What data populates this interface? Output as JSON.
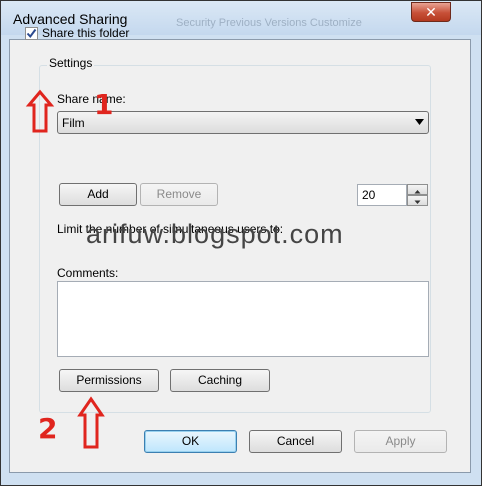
{
  "window": {
    "title": "Advanced Sharing",
    "background_text": "Security    Previous Versions    Customize",
    "close_glyph": "✕"
  },
  "share": {
    "checkbox_label": "Share this folder",
    "checked": true
  },
  "settings": {
    "group_label": "Settings",
    "share_name_label": "Share name:",
    "share_name_value": "Film",
    "add_label": "Add",
    "remove_label": "Remove",
    "limit_label": "Limit the number of simultaneous users to:",
    "limit_value": "20",
    "comments_label": "Comments:",
    "comments_value": "",
    "permissions_label": "Permissions",
    "caching_label": "Caching"
  },
  "footer": {
    "ok_label": "OK",
    "cancel_label": "Cancel",
    "apply_label": "Apply"
  },
  "annotations": {
    "marker_1": "1",
    "marker_2": "2",
    "watermark": "arifuw.blogspot.com",
    "color": "#e0251e"
  }
}
